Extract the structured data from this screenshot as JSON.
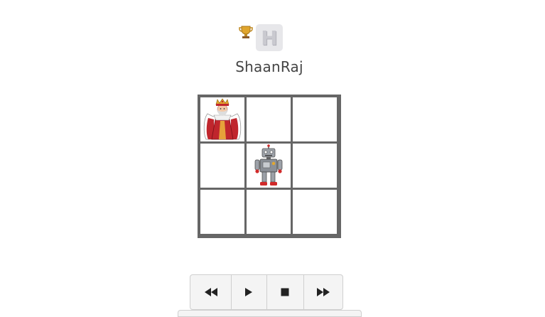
{
  "player": {
    "username": "ShaanRaj",
    "avatar_letter": "H",
    "trophy_icon": "trophy-icon"
  },
  "board": {
    "rows": 3,
    "cols": 3,
    "cells": [
      [
        "queen",
        "",
        ""
      ],
      [
        "",
        "robot",
        ""
      ],
      [
        "",
        "",
        ""
      ]
    ]
  },
  "controls": [
    {
      "name": "rewind-button",
      "icon": "rewind-icon"
    },
    {
      "name": "play-button",
      "icon": "play-icon"
    },
    {
      "name": "stop-button",
      "icon": "stop-icon"
    },
    {
      "name": "fast-forward-button",
      "icon": "fast-forward-icon"
    }
  ],
  "colors": {
    "grid": "#666666",
    "queen_robe": "#c0262d",
    "queen_crown": "#e2a72e",
    "robot_body": "#8a8f96",
    "robot_accent": "#d02a2a"
  }
}
